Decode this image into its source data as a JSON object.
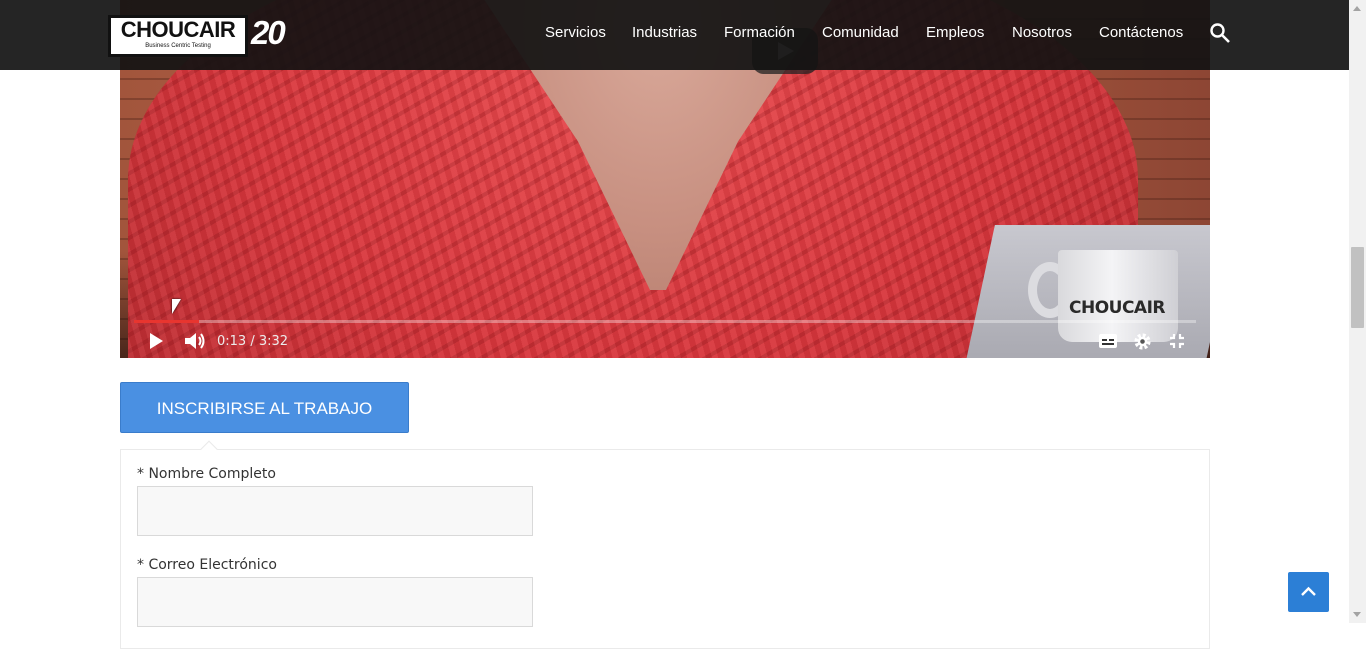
{
  "header": {
    "logo_text": "CHOUCAIR",
    "logo_tagline": "Business Centric Testing",
    "logo_badge": "20",
    "nav": [
      {
        "label": "Servicios"
      },
      {
        "label": "Industrias"
      },
      {
        "label": "Formación"
      },
      {
        "label": "Comunidad"
      },
      {
        "label": "Empleos"
      },
      {
        "label": "Nosotros"
      },
      {
        "label": "Contáctenos"
      }
    ],
    "search_icon": "search-icon"
  },
  "video": {
    "mug_text": "CHOUCAIR",
    "time_display": "0:13 / 3:32",
    "progress": 0.061,
    "progress_color": "#e8352f",
    "controls": {
      "play_icon": "play-icon",
      "volume_icon": "volume-icon",
      "subtitles_icon": "subtitles-icon",
      "settings_icon": "gear-icon",
      "exit_fullscreen_icon": "exit-fullscreen-icon"
    }
  },
  "apply": {
    "button_label": "INSCRIBIRSE AL TRABAJO",
    "accent_color": "#4a90e2"
  },
  "form": {
    "fields": [
      {
        "label": "* Nombre Completo",
        "value": ""
      },
      {
        "label": "* Correo Electrónico",
        "value": ""
      }
    ]
  },
  "scroll_top_icon": "chevron-up-icon"
}
